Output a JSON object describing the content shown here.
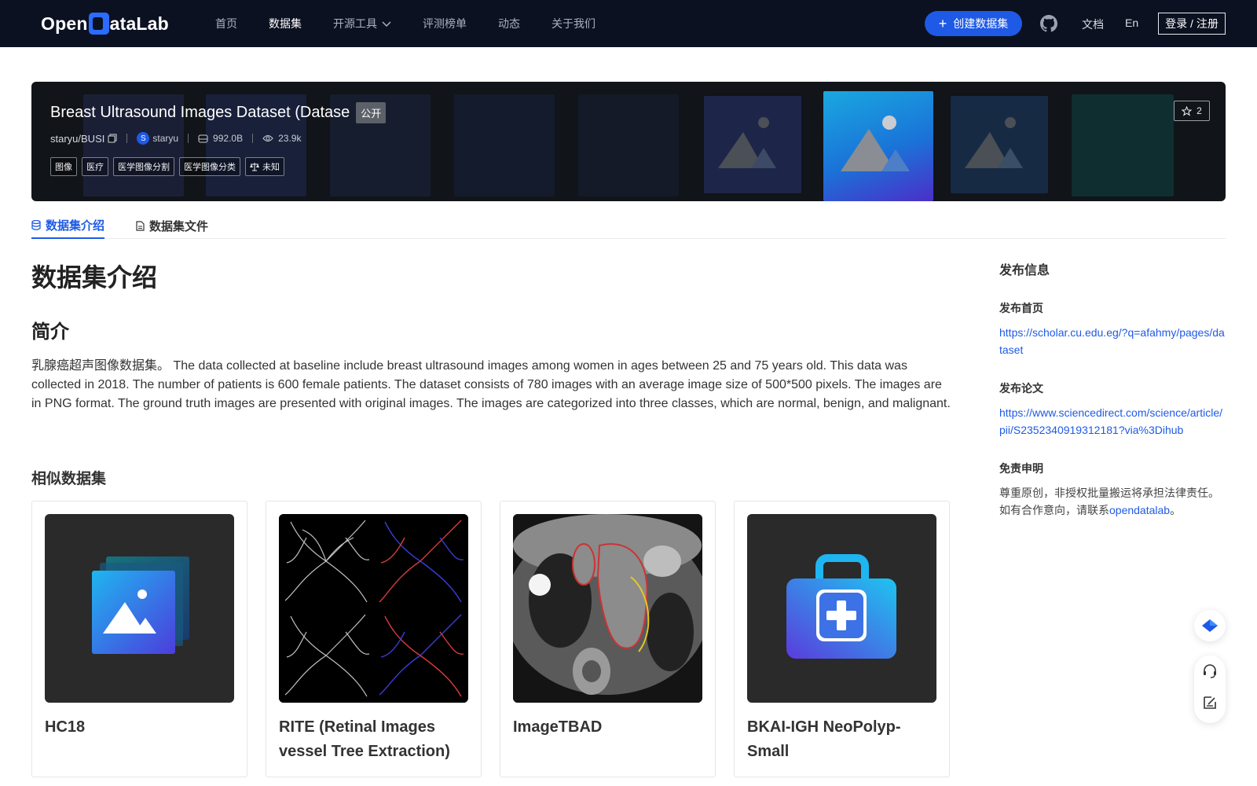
{
  "nav": {
    "logo_pre": "Open",
    "logo_d": "D",
    "logo_post": "ataLab",
    "links": [
      "首页",
      "数据集",
      "开源工具",
      "评测榜单",
      "动态",
      "关于我们"
    ],
    "create_label": "创建数据集",
    "docs": "文档",
    "lang": "En",
    "login": "登录 / 注册"
  },
  "banner": {
    "title": "Breast Ultrasound Images Dataset (Datase",
    "visibility": "公开",
    "repo": "staryu/BUSI",
    "owner_initial": "S",
    "owner": "staryu",
    "size": "992.0B",
    "views": "23.9k",
    "tags": [
      "图像",
      "医疗",
      "医学图像分割",
      "医学图像分类"
    ],
    "license": "未知",
    "stars": "2"
  },
  "tabs": [
    "数据集介绍",
    "数据集文件"
  ],
  "main": {
    "heading": "数据集介绍",
    "intro_heading": "简介",
    "description": "乳腺癌超声图像数据集。 The data collected at baseline include breast ultrasound images among women in ages between 25 and 75 years old. This data was collected in 2018. The number of patients is 600 female patients. The dataset consists of 780 images with an average image size of 500*500 pixels. The images are in PNG format. The ground truth images are presented with original images. The images are categorized into three classes, which are normal, benign, and malignant.",
    "similar_heading": "相似数据集",
    "similar": [
      {
        "name": "HC18",
        "thumb": "image-icon"
      },
      {
        "name": "RITE (Retinal Images vessel Tree Extraction)",
        "thumb": "retina-vessels"
      },
      {
        "name": "ImageTBAD",
        "thumb": "ct-scan"
      },
      {
        "name": "BKAI-IGH NeoPolyp-Small",
        "thumb": "medkit-icon"
      }
    ]
  },
  "sidebar": {
    "title": "发布信息",
    "homepage_label": "发布首页",
    "homepage_url": "https://scholar.cu.edu.eg/?q=afahmy/pages/dataset",
    "paper_label": "发布论文",
    "paper_url": "https://www.sciencedirect.com/science/article/pii/S2352340919312181?via%3Dihub",
    "disclaimer_label": "免责申明",
    "disclaimer_line1": "尊重原创，非授权批量搬运将承担法律责任。",
    "disclaimer_pre": "如有合作意向，请联系",
    "disclaimer_link": "opendatalab",
    "disclaimer_post": "。"
  },
  "colors": {
    "nav_bg": "#0b1120",
    "accent": "#1e5ae6",
    "banner_bg": "#111418"
  }
}
